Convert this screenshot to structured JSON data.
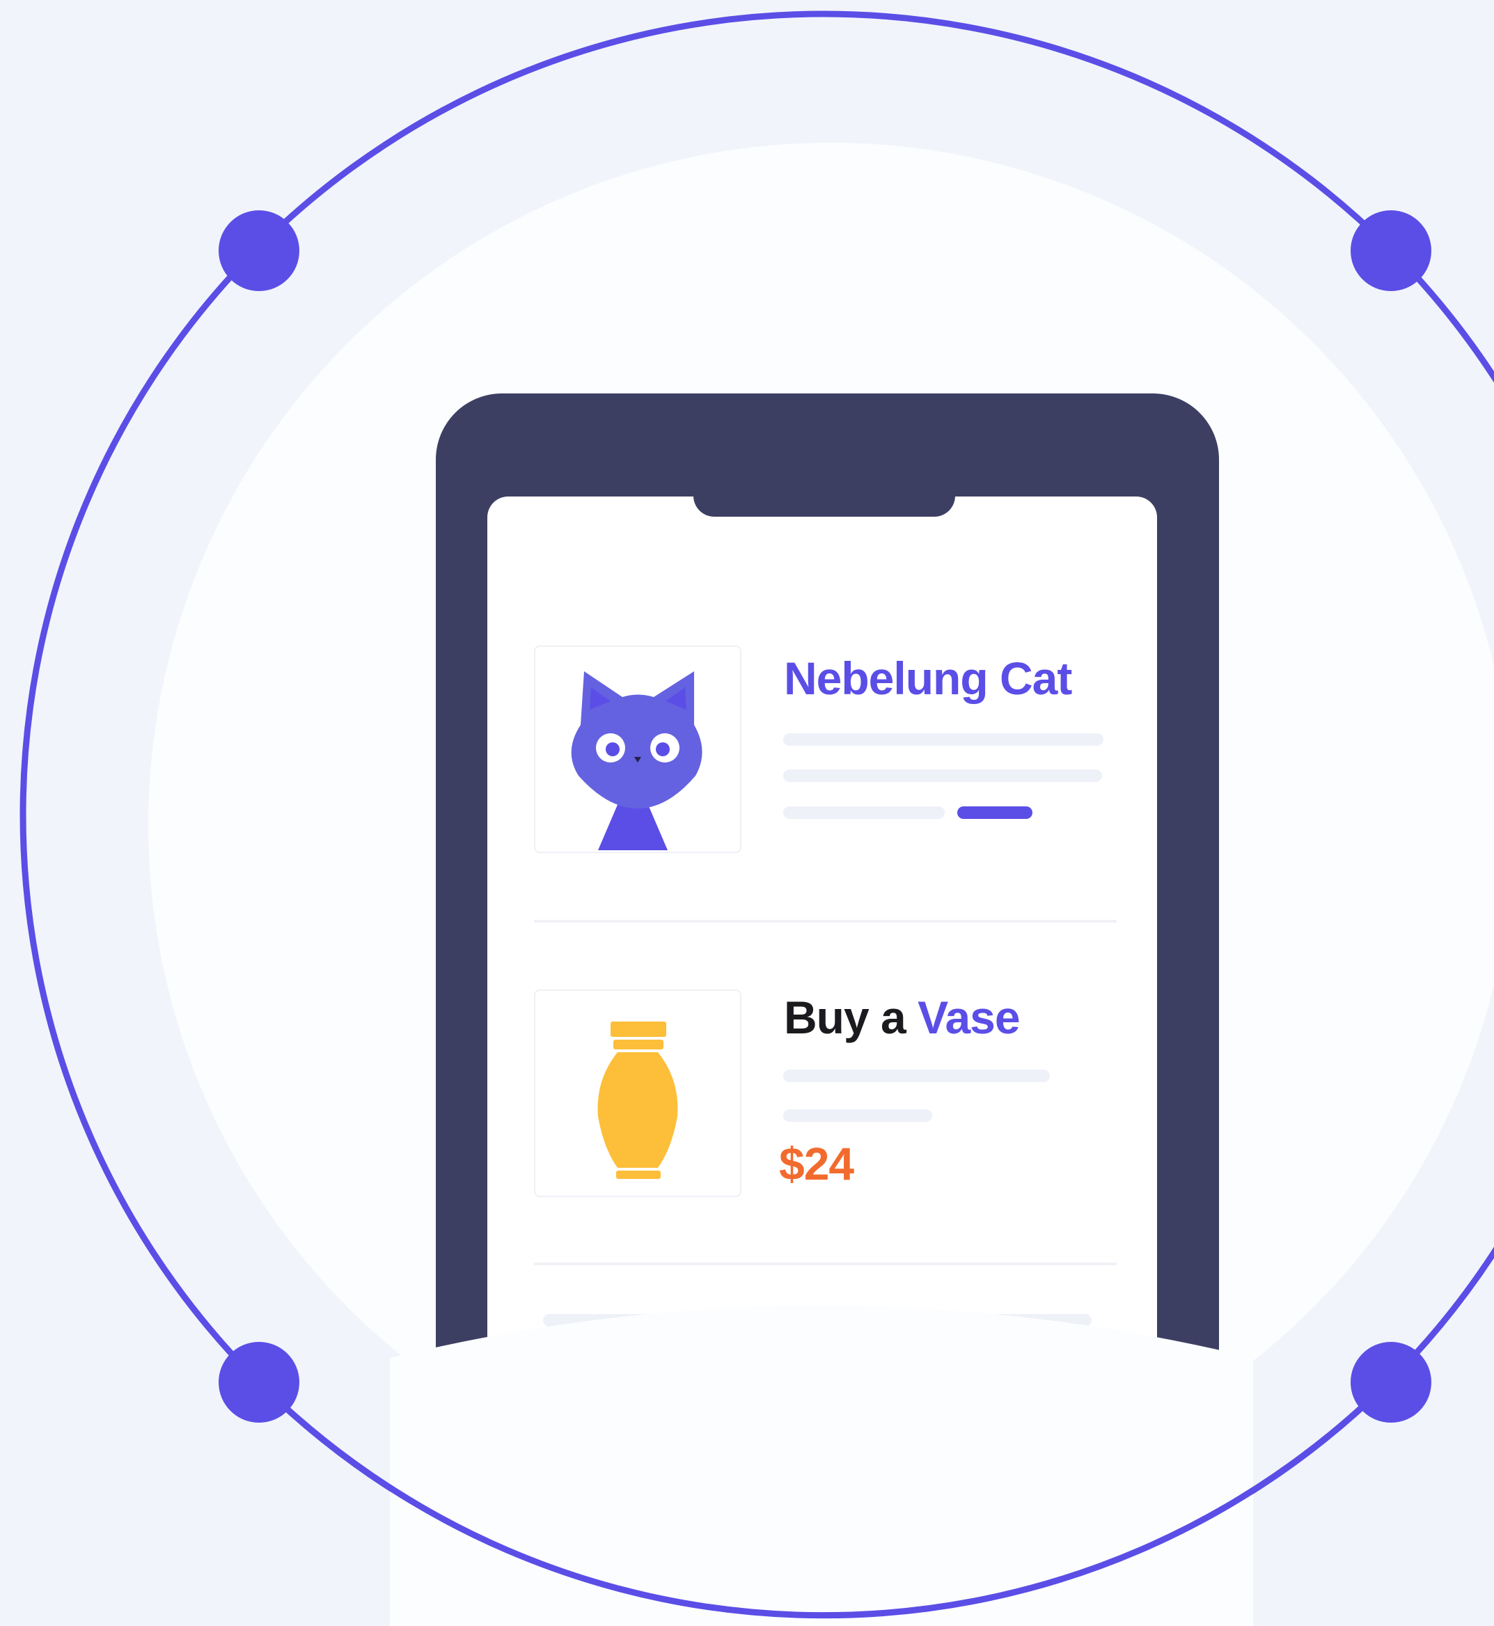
{
  "colors": {
    "accent": "#5B4EE6",
    "phone_body": "#3D3F62",
    "price": "#F26B2E",
    "vase": "#FDBE3A",
    "background": "#F1F4FB"
  },
  "products": [
    {
      "title_part1": "Nebelung Cat",
      "title_part2": "",
      "icon": "cat-icon"
    },
    {
      "title_part1": "Buy a ",
      "title_part2": "Vase",
      "price": "$24",
      "icon": "vase-icon"
    }
  ]
}
